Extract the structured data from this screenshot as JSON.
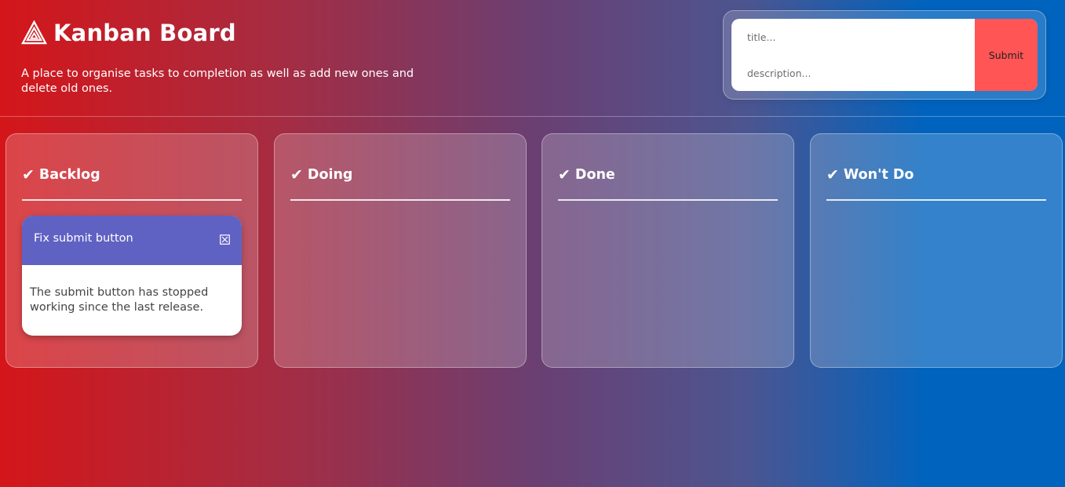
{
  "header": {
    "title": "Kanban Board",
    "logo_icon": "triangle-logo-icon",
    "tagline": "A place to organise tasks to completion as well as add new ones and delete old ones."
  },
  "form": {
    "title_placeholder": "title...",
    "title_value": "",
    "description_placeholder": "description...",
    "description_value": "",
    "submit_label": "Submit"
  },
  "columns": [
    {
      "label": "Backlog",
      "icon": "check-icon",
      "tasks": [
        {
          "title": "Fix submit button",
          "description": "The submit button has stopped working since the last release.",
          "delete_icon": "close-box-icon"
        }
      ]
    },
    {
      "label": "Doing",
      "icon": "check-icon",
      "tasks": []
    },
    {
      "label": "Done",
      "icon": "check-icon",
      "tasks": []
    },
    {
      "label": "Won't Do",
      "icon": "check-icon",
      "tasks": []
    }
  ],
  "colors": {
    "gradient_start": "#d4161a",
    "gradient_end": "#0063be",
    "card_header": "#6062c3",
    "submit_button": "#ff5555"
  }
}
